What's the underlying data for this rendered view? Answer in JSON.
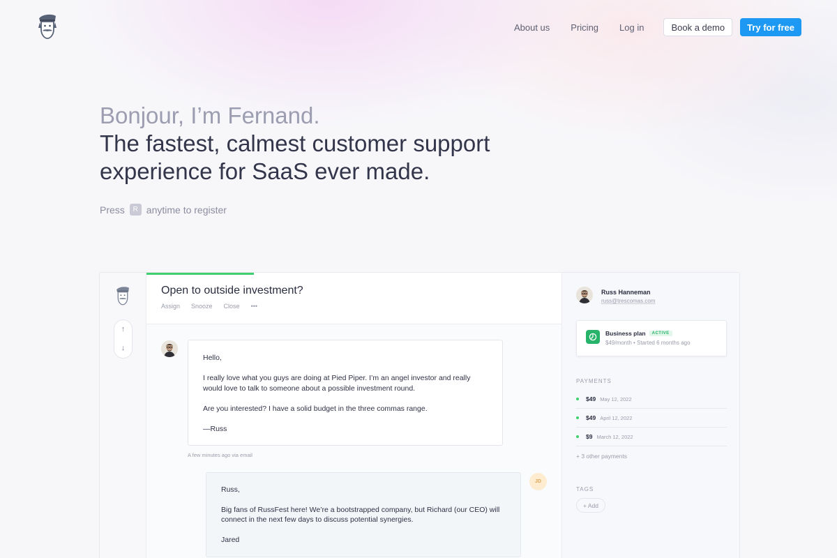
{
  "nav": {
    "about": "About us",
    "pricing": "Pricing",
    "login": "Log in",
    "book_demo": "Book a demo",
    "try_free": "Try for free"
  },
  "hero": {
    "greeting": "Bonjour, I’m Fernand.",
    "headline_line1": "The fastest, calmest customer support",
    "headline_line2": "experience for SaaS ever made.",
    "press_prefix": "Press",
    "press_key": "R",
    "press_suffix": "anytime to register"
  },
  "conversation": {
    "title": "Open to outside investment?",
    "actions": [
      "Assign",
      "Snooze",
      "Close",
      "•••"
    ],
    "message1": {
      "greeting": "Hello,",
      "body1": "I really love what you guys are doing at Pied Piper. I’m an angel investor and really would love to talk to someone about a possible investment round.",
      "body2": "Are you interested? I have a solid budget in the three commas range.",
      "signoff": "—Russ",
      "meta": "A few minutes ago via email"
    },
    "message2": {
      "greeting": "Russ,",
      "body1": "Big fans of RussFest here! We’re a bootstrapped company, but Richard (our CEO) will connect in the next few days to discuss potential synergies.",
      "signoff": "Jared",
      "avatar_initials": "JD"
    }
  },
  "rail": {
    "up_icon": "↑",
    "down_icon": "↓"
  },
  "customer": {
    "name": "Russ Hanneman",
    "email": "russ@trescomas.com",
    "plan_name": "Business plan",
    "plan_badge": "ACTIVE",
    "plan_details": "$49/month  •  Started 6 months ago"
  },
  "payments": {
    "label": "PAYMENTS",
    "items": [
      {
        "amount": "$49",
        "date": "May 12, 2022"
      },
      {
        "amount": "$49",
        "date": "April 12, 2022"
      },
      {
        "amount": "$9",
        "date": "March 12, 2022"
      }
    ],
    "more": "+ 3 other payments"
  },
  "tags": {
    "label": "TAGS",
    "add": "+ Add"
  },
  "colors": {
    "accent": "#1d99f3",
    "success": "#3fcf6e"
  }
}
